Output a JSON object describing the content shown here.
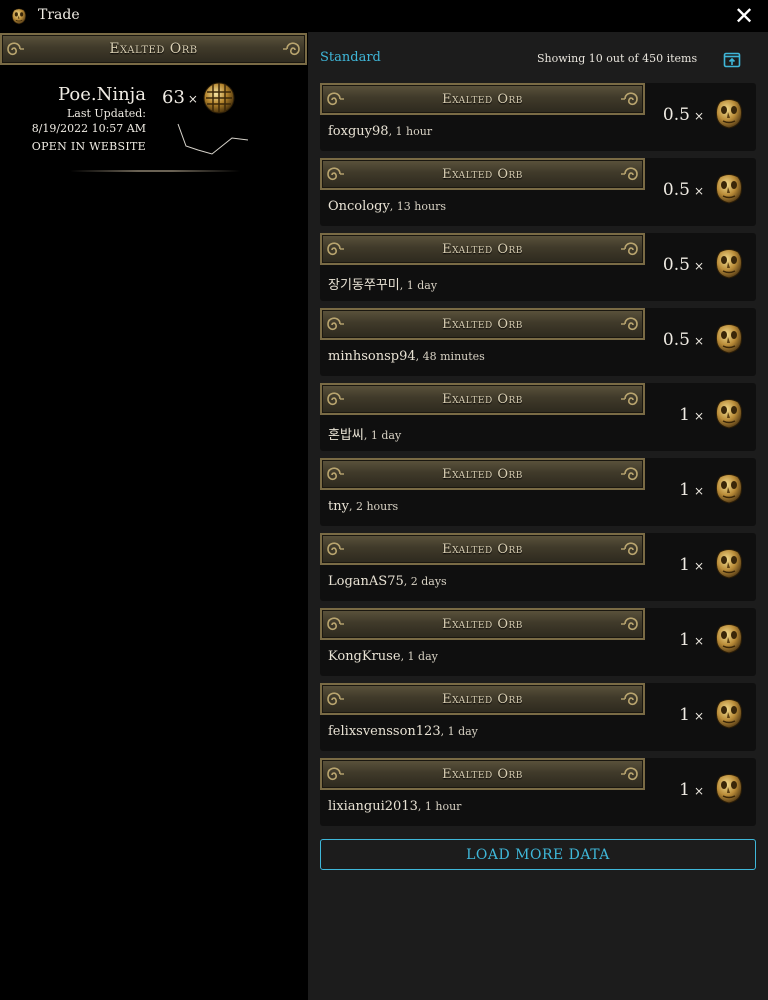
{
  "window": {
    "title": "Trade",
    "close_glyph": "✕",
    "icon": "exalted-orb-icon"
  },
  "left": {
    "item_banner": "Exalted Orb",
    "ninja": {
      "name": "Poe.Ninja",
      "updated_label": "Last Updated:",
      "updated_date": "8/19/2022 10:57 AM",
      "open_link": "OPEN IN WEBSITE",
      "price": "63",
      "price_suffix": "×",
      "price_icon": "chaos-orb-icon"
    }
  },
  "right": {
    "league": "Standard",
    "showing": "Showing 10 out of 450 items",
    "open_icon": "open-external-icon",
    "load_more": "LOAD MORE DATA",
    "listings": [
      {
        "item": "Exalted Orb",
        "seller": "foxguy98",
        "age": ", 1 hour",
        "amount": "0.5",
        "suffix": "×"
      },
      {
        "item": "Exalted Orb",
        "seller": "Oncology",
        "age": ", 13 hours",
        "amount": "0.5",
        "suffix": "×"
      },
      {
        "item": "Exalted Orb",
        "seller": "장기동쭈꾸미",
        "age": ", 1 day",
        "amount": "0.5",
        "suffix": "×"
      },
      {
        "item": "Exalted Orb",
        "seller": "minhsonsp94",
        "age": ", 48 minutes",
        "amount": "0.5",
        "suffix": "×"
      },
      {
        "item": "Exalted Orb",
        "seller": "혼밥씨",
        "age": ", 1 day",
        "amount": "1",
        "suffix": "×"
      },
      {
        "item": "Exalted Orb",
        "seller": "tny",
        "age": ", 2 hours",
        "amount": "1",
        "suffix": "×"
      },
      {
        "item": "Exalted Orb",
        "seller": "LoganAS75",
        "age": ", 2 days",
        "amount": "1",
        "suffix": "×"
      },
      {
        "item": "Exalted Orb",
        "seller": "KongKruse",
        "age": ", 1 day",
        "amount": "1",
        "suffix": "×"
      },
      {
        "item": "Exalted Orb",
        "seller": "felixsvensson123",
        "age": ", 1 day",
        "amount": "1",
        "suffix": "×"
      },
      {
        "item": "Exalted Orb",
        "seller": "lixiangui2013",
        "age": ", 1 hour",
        "amount": "1",
        "suffix": "×"
      }
    ]
  },
  "colors": {
    "accent": "#3fb7d9",
    "banner": "#4a4330",
    "panel": "#1c1c1c",
    "card": "#0f0f0f"
  }
}
